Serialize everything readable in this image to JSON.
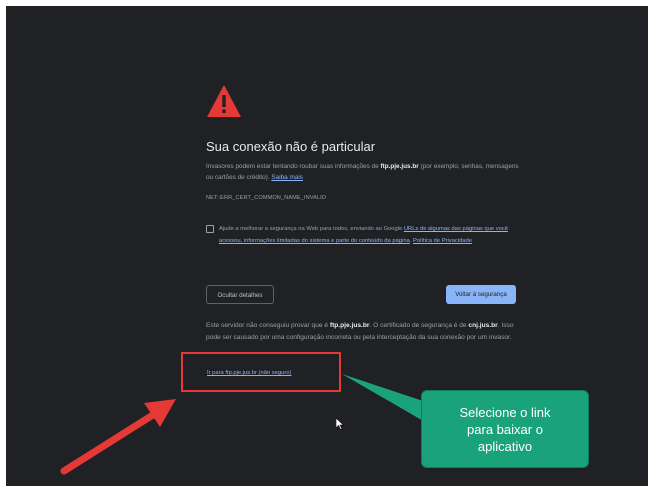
{
  "page": {
    "title": "Sua conexão não é particular",
    "description_part1": "Invasores podem estar tentando roubar suas informações de ",
    "description_host": "ftp.pje.jus.br",
    "description_part2": " (por exemplo, senhas, mensagens ou cartões de crédito). ",
    "learn_more": "Saiba mais",
    "error_code": "NET::ERR_CERT_COMMON_NAME_INVALID",
    "checkbox_text_part1": "Ajude a melhorar a segurança na Web para todos, enviando ao Google ",
    "checkbox_link": "URLs de algumas das páginas que você acessou, informações limitadas do sistema e parte do conteúdo da página",
    "checkbox_text_part2": ". ",
    "privacy_link": "Política de Privacidade",
    "hide_details_button": "Ocultar detalhes",
    "back_to_safety_button": "Voltar à segurança",
    "details_part1": "Este servidor não conseguiu provar que é ",
    "details_host": "ftp.pje.jus.br",
    "details_part2": ". O certificado de segurança é de ",
    "details_cert_host": "cnj.jus.br",
    "details_part3": ". Isso pode ser causado por uma configuração incorreta ou pela interceptação da sua conexão por um invasor.",
    "proceed_link": "Ir para ftp.pje.jus.br (não seguro)"
  },
  "annotation": {
    "callout_line1": "Selecione o link",
    "callout_line2": "para baixar o",
    "callout_line3": "aplicativo",
    "box_color": "#e53935",
    "callout_color": "#1aa37a"
  },
  "colors": {
    "background": "#202124",
    "link": "#8ab4f8",
    "warning_icon": "#e53935",
    "primary_button": "#8ab4f8"
  },
  "icons": {
    "warning": "warning-triangle-icon",
    "arrow": "red-arrow-icon",
    "cursor": "mouse-cursor-icon"
  }
}
